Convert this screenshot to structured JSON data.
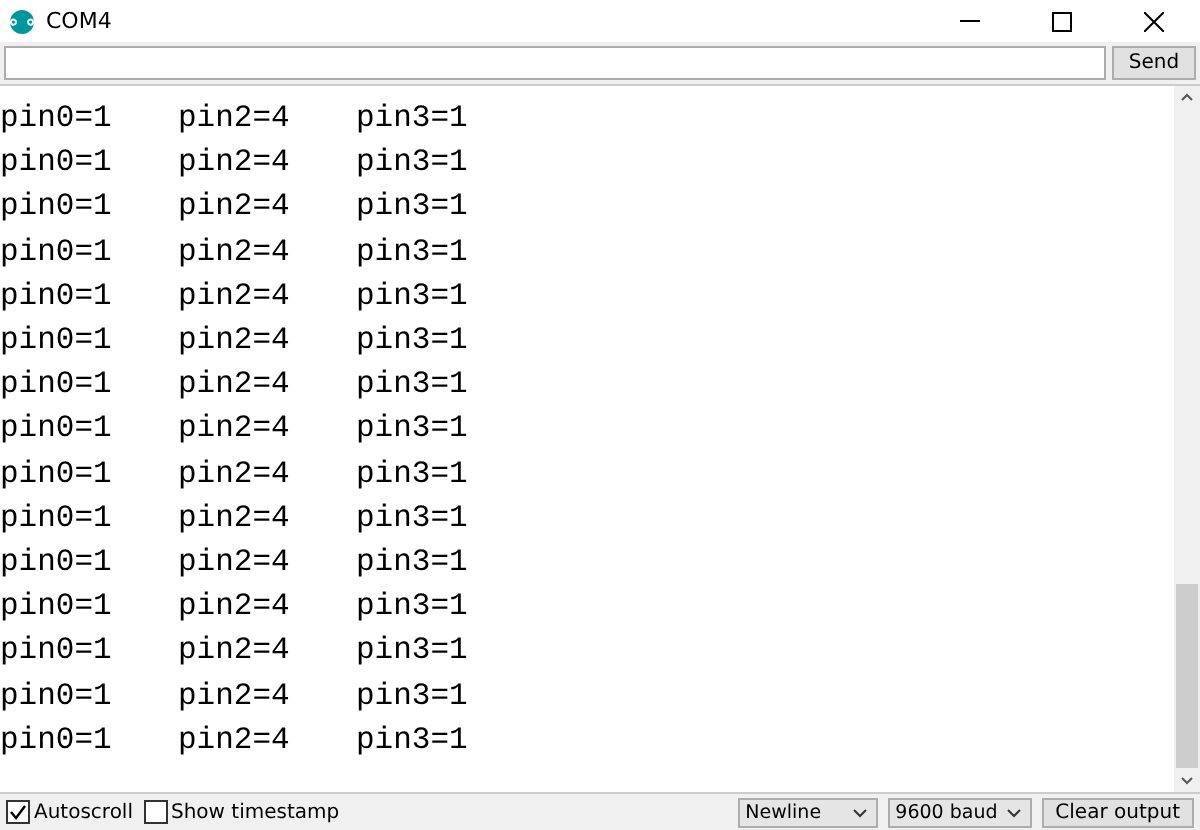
{
  "window": {
    "title": "COM4"
  },
  "input": {
    "button": "Send"
  },
  "output": {
    "lines": [
      [
        "pin0=1",
        "pin2=4",
        "pin3=1"
      ],
      [
        "pin0=1",
        "pin2=4",
        "pin3=1"
      ],
      [
        "pin0=1",
        "pin2=4",
        "pin3=1"
      ],
      [
        "pin0=1",
        "pin2=4",
        "pin3=1"
      ],
      [
        "pin0=1",
        "pin2=4",
        "pin3=1"
      ],
      [
        "pin0=1",
        "pin2=4",
        "pin3=1"
      ],
      [
        "pin0=1",
        "pin2=4",
        "pin3=1"
      ],
      [
        "pin0=1",
        "pin2=4",
        "pin3=1"
      ],
      [
        "pin0=1",
        "pin2=4",
        "pin3=1"
      ],
      [
        "pin0=1",
        "pin2=4",
        "pin3=1"
      ],
      [
        "pin0=1",
        "pin2=4",
        "pin3=1"
      ],
      [
        "pin0=1",
        "pin2=4",
        "pin3=1"
      ],
      [
        "pin0=1",
        "pin2=4",
        "pin3=1"
      ],
      [
        "pin0=1",
        "pin2=4",
        "pin3=1"
      ],
      [
        "pin0=1",
        "pin2=4",
        "pin3=1"
      ]
    ]
  },
  "status_bar": {
    "checkboxes": [
      {
        "label": "Autoscroll",
        "checked": true
      },
      {
        "label": "Show timestamp",
        "checked": false
      }
    ],
    "dropdowns": [
      {
        "value": "Newline"
      },
      {
        "value": "9600 baud"
      }
    ],
    "button": "Clear output"
  }
}
